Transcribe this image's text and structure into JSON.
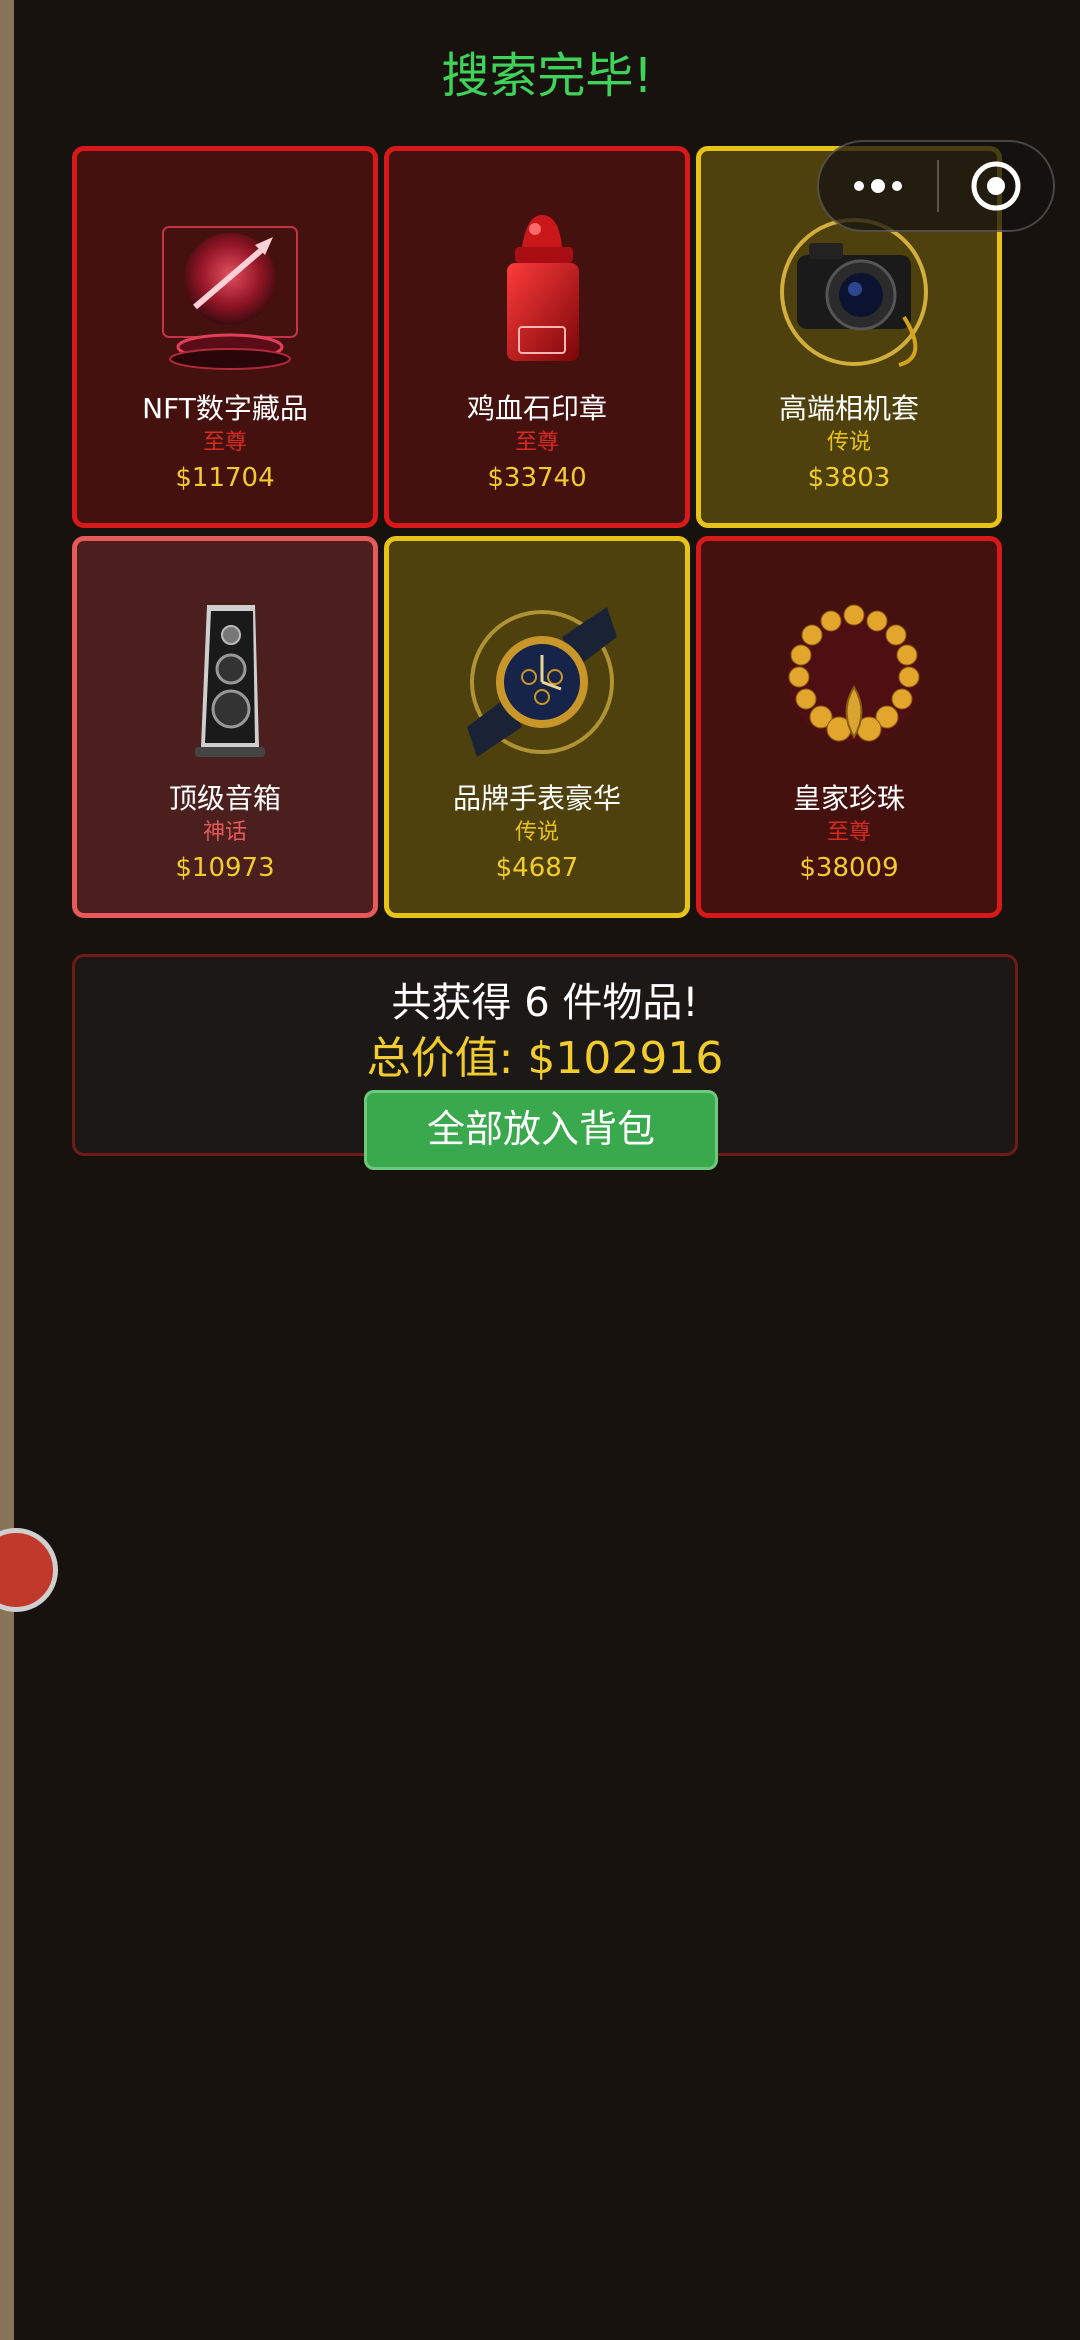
{
  "header": {
    "title": "搜索完毕!"
  },
  "items": [
    {
      "name": "NFT数字藏品",
      "rarity": "至尊",
      "price": "$11704",
      "icon": "nft-hologram-icon"
    },
    {
      "name": "鸡血石印章",
      "rarity": "至尊",
      "price": "$33740",
      "icon": "bloodstone-seal-icon"
    },
    {
      "name": "高端相机套",
      "rarity": "传说",
      "price": "$3803",
      "icon": "camera-icon"
    },
    {
      "name": "顶级音箱",
      "rarity": "神话",
      "price": "$10973",
      "icon": "speaker-icon"
    },
    {
      "name": "品牌手表豪华",
      "rarity": "传说",
      "price": "$4687",
      "icon": "watch-icon"
    },
    {
      "name": "皇家珍珠",
      "rarity": "至尊",
      "price": "$38009",
      "icon": "pearl-necklace-icon"
    }
  ],
  "summary": {
    "count_text": "共获得 6 件物品!",
    "total_text": "总价值: $102916",
    "button_label": "全部放入背包"
  },
  "colors": {
    "supreme_border": "#d7191a",
    "legend_border": "#e8c317",
    "myth_border": "#e7595a",
    "title_green": "#3fd35a",
    "price_gold": "#f1cc2c",
    "button_green": "#3aa84c"
  }
}
